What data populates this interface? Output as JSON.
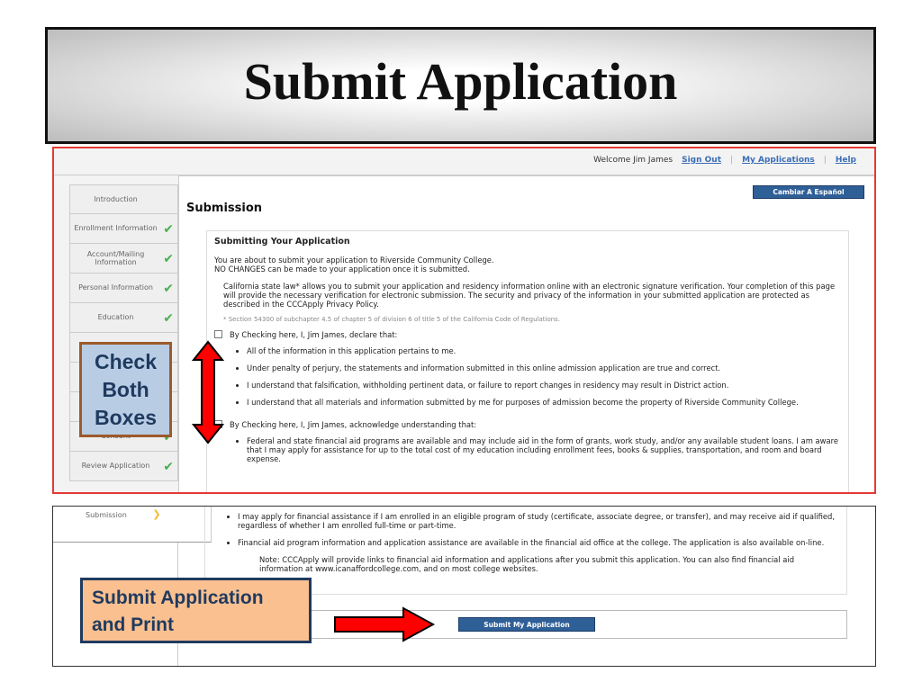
{
  "slide_title": "Submit Application",
  "header": {
    "welcome": "Welcome Jim James",
    "sign_out": "Sign Out",
    "my_applications": "My Applications",
    "help": "Help",
    "separator": "|"
  },
  "language_button": "Cambiar A Español",
  "sidebar": {
    "items": [
      {
        "label": "Introduction",
        "done": false
      },
      {
        "label": "Enrollment Information",
        "done": true
      },
      {
        "label": "Account/Mailing Information",
        "done": true
      },
      {
        "label": "Personal Information",
        "done": true
      },
      {
        "label": "Education",
        "done": true
      },
      {
        "label": "C",
        "done": true
      },
      {
        "label": "",
        "done": true
      },
      {
        "label": "",
        "done": true
      },
      {
        "label": "Consent",
        "done": true
      },
      {
        "label": "Review Application",
        "done": true
      },
      {
        "label": "Submission",
        "done": false,
        "current": true
      }
    ],
    "check_glyph": "✔",
    "current_glyph": "❯"
  },
  "main": {
    "heading": "Submission",
    "section_title": "Submitting Your Application",
    "intro1": "You are about to submit your application to Riverside Community College.",
    "intro2": "NO CHANGES can be made to your application once it is submitted.",
    "law": "California state law* allows you to submit your application and residency information online with an electronic signature verification. Your completion of this page will provide the necessary verification for electronic submission. The security and privacy of the information in your submitted application are protected as described in the CCCApply Privacy Policy.",
    "footnote": "* Section 54300 of subchapter 4.5 of chapter 5 of division 6 of title 5 of the California Code of Regulations.",
    "declare_label": "By Checking here, I, Jim James, declare that:",
    "declare_items": [
      "All of the information in this application pertains to me.",
      "Under penalty of perjury, the statements and information submitted in this online admission application are true and correct.",
      "I understand that falsification, withholding pertinent data, or failure to report changes in residency may result in District action.",
      "I understand that all materials and information submitted by me for purposes of admission become the property of Riverside Community College."
    ],
    "acknowledge_label": "By Checking here, I, Jim James, acknowledge understanding that:",
    "acknowledge_items": [
      "Federal and state financial aid programs are available and may include aid in the form of grants, work study, and/or any available student loans. I am aware that I may apply for assistance for up to the total cost of my education including enrollment fees, books & supplies, transportation, and room and board expense.",
      "I may apply for financial assistance if I am enrolled in an eligible program of study (certificate, associate degree, or transfer), and may receive aid if qualified, regardless of whether I am enrolled full-time or part-time.",
      "Financial aid program information and application assistance are available in the financial aid office at the college. The application is also available on-line."
    ],
    "note": "Note: CCCApply will provide links to financial aid information and applications after you submit this application. You can also find financial aid information at www.icanaffordcollege.com, and on most college websites.",
    "submit_button": "Submit My Application"
  },
  "callouts": {
    "check_both": [
      "Check",
      "Both",
      "Boxes"
    ],
    "submit_print": [
      "Submit Application",
      "and Print"
    ]
  },
  "colors": {
    "accent_red": "#ff0000",
    "button_blue": "#2f5f97",
    "check_green": "#4caf50",
    "callout_blue": "#b8cce4",
    "callout_orange": "#fac090"
  }
}
